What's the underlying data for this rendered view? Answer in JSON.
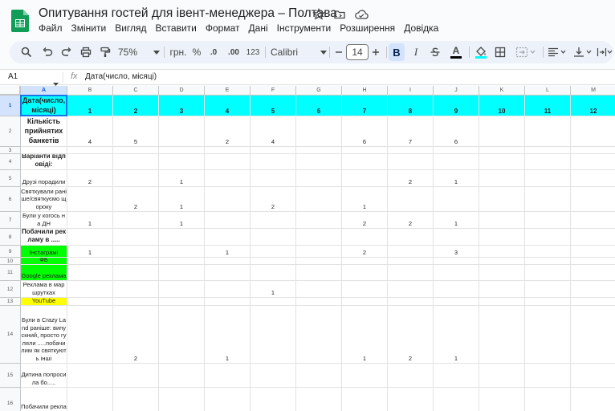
{
  "doc": {
    "title": "Опитування гостей для івент-менеджера – Полтава",
    "menu": [
      "Файл",
      "Змінити",
      "Вигляд",
      "Вставити",
      "Формат",
      "Дані",
      "Інструменти",
      "Розширення",
      "Довідка"
    ]
  },
  "toolbar": {
    "zoom": "75%",
    "currency": "грн.",
    "percent": "%",
    "dec_decrease": ".0",
    "dec_increase": ".00",
    "more_formats": "123",
    "font": "Calibri",
    "font_size": "14",
    "bold": "B",
    "italic": "I",
    "text_color_letter": "A"
  },
  "formula_bar": {
    "name_box": "A1",
    "fx": "fx",
    "formula": "Дата(число, місяці)"
  },
  "colors": {
    "cyan": "#00ffff",
    "green": "#00ff00",
    "yellow": "#ffff00",
    "accent": "#1a73e8",
    "sheets_green": "#0f9d58"
  },
  "columns": [
    "A",
    "B",
    "C",
    "D",
    "E",
    "F",
    "G",
    "H",
    "I",
    "J",
    "K",
    "L",
    "M"
  ],
  "rows": [
    {
      "n": "1",
      "a": "Дата(число, місяці)",
      "vals": [
        "1",
        "2",
        "3",
        "4",
        "5",
        "6",
        "7",
        "8",
        "9",
        "10",
        "11",
        "12"
      ]
    },
    {
      "n": "2",
      "a": "Кількість прийнятих банкетів",
      "vals": [
        "4",
        "5",
        "",
        "2",
        "4",
        "",
        "6",
        "7",
        "6",
        "",
        "",
        ""
      ]
    },
    {
      "n": "3",
      "a": "",
      "vals": [
        "",
        "",
        "",
        "",
        "",
        "",
        "",
        "",
        "",
        "",
        "",
        ""
      ]
    },
    {
      "n": "4",
      "a": "Варіанти відповіді:",
      "vals": [
        "",
        "",
        "",
        "",
        "",
        "",
        "",
        "",
        "",
        "",
        "",
        ""
      ]
    },
    {
      "n": "5",
      "a": "Друзі порадили",
      "vals": [
        "2",
        "",
        "1",
        "",
        "",
        "",
        "",
        "2",
        "1",
        "",
        "",
        ""
      ]
    },
    {
      "n": "6",
      "a": "Святкували раніше/святкуємо щороку",
      "vals": [
        "",
        "2",
        "1",
        "",
        "2",
        "",
        "1",
        "",
        "",
        "",
        "",
        ""
      ]
    },
    {
      "n": "7",
      "a": "Були у когось на ДН",
      "vals": [
        "1",
        "",
        "1",
        "",
        "",
        "",
        "2",
        "2",
        "1",
        "",
        "",
        ""
      ]
    },
    {
      "n": "8",
      "a": "Побачили рекламу в .....",
      "vals": [
        "",
        "",
        "",
        "",
        "",
        "",
        "",
        "",
        "",
        "",
        "",
        ""
      ]
    },
    {
      "n": "9",
      "a": "Інстаграмі",
      "vals": [
        "1",
        "",
        "",
        "1",
        "",
        "",
        "2",
        "",
        "3",
        "",
        "",
        ""
      ]
    },
    {
      "n": "10",
      "a": "ФБ",
      "vals": [
        "",
        "",
        "",
        "",
        "",
        "",
        "",
        "",
        "",
        "",
        "",
        ""
      ]
    },
    {
      "n": "11",
      "a": "Google реклама",
      "vals": [
        "",
        "",
        "",
        "",
        "",
        "",
        "",
        "",
        "",
        "",
        "",
        ""
      ]
    },
    {
      "n": "12",
      "a": "Реклама в маршрутках",
      "vals": [
        "",
        "",
        "",
        "",
        "1",
        "",
        "",
        "",
        "",
        "",
        "",
        ""
      ]
    },
    {
      "n": "13",
      "a": "YouTube",
      "vals": [
        "",
        "",
        "",
        "",
        "",
        "",
        "",
        "",
        "",
        "",
        "",
        ""
      ]
    },
    {
      "n": "14",
      "a": "Були в Crazy Land раніше: випускний, просто гуляли .....побачилим як святкують інші",
      "vals": [
        "",
        "2",
        "",
        "1",
        "",
        "",
        "1",
        "2",
        "1",
        "",
        "",
        ""
      ]
    },
    {
      "n": "15",
      "a": "Дитина попросила бо.....",
      "vals": [
        "",
        "",
        "",
        "",
        "",
        "",
        "",
        "",
        "",
        "",
        "",
        ""
      ]
    },
    {
      "n": "16",
      "a": "Побачили рекламу в",
      "vals": [
        "",
        "",
        "",
        "",
        "",
        "",
        "",
        "",
        "",
        "",
        "",
        ""
      ]
    }
  ]
}
